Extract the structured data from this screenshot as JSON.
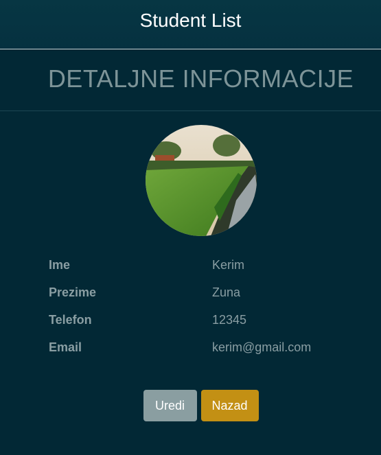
{
  "header": {
    "title": "Student List"
  },
  "section": {
    "title": "DETALJNE INFORMACIJE"
  },
  "avatar": {
    "icon": "student-photo-garden-lawn"
  },
  "details": [
    {
      "label": "Ime",
      "value": "Kerim"
    },
    {
      "label": "Prezime",
      "value": "Zuna"
    },
    {
      "label": "Telefon",
      "value": "12345"
    },
    {
      "label": "Email",
      "value": "kerim@gmail.com"
    }
  ],
  "actions": {
    "edit_label": "Uredi",
    "back_label": "Nazad"
  },
  "colors": {
    "background": "#022835",
    "edit": "#8a9ea1",
    "back": "#c39014"
  }
}
